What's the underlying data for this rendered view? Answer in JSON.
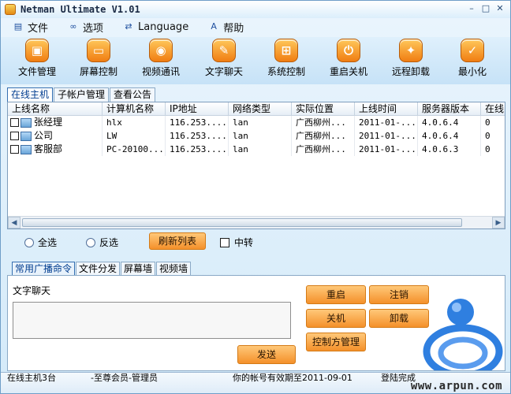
{
  "window": {
    "title": "Netman Ultimate V1.01",
    "min": "–",
    "max": "□",
    "close": "✕"
  },
  "menu": [
    {
      "label": "文件",
      "icon": "document-icon",
      "glyph": "▤"
    },
    {
      "label": "选项",
      "icon": "glasses-icon",
      "glyph": "∞"
    },
    {
      "label": "Language",
      "icon": "translate-icon",
      "glyph": "⇄"
    },
    {
      "label": "帮助",
      "icon": "font-help-icon",
      "glyph": "A"
    }
  ],
  "toolbar": [
    {
      "label": "文件管理",
      "icon": "folder-shield-icon",
      "glyph": "▣"
    },
    {
      "label": "屏幕控制",
      "icon": "monitor-icon",
      "glyph": "▭"
    },
    {
      "label": "视频通讯",
      "icon": "webcam-icon",
      "glyph": "◉"
    },
    {
      "label": "文字聊天",
      "icon": "chat-bubble-icon",
      "glyph": "✎"
    },
    {
      "label": "系统控制",
      "icon": "windows-logo-icon",
      "glyph": "⊞"
    },
    {
      "label": "重启关机",
      "icon": "power-icon",
      "glyph": "⏻"
    },
    {
      "label": "远程卸载",
      "icon": "wand-icon",
      "glyph": "✦"
    },
    {
      "label": "最小化",
      "icon": "minimize-check-icon",
      "glyph": "✓"
    }
  ],
  "main_tabs": [
    "在线主机",
    "子帐户管理",
    "查看公告"
  ],
  "table": {
    "columns": [
      "上线名称",
      "计算机名称",
      "IP地址",
      "网络类型",
      "实际位置",
      "上线时间",
      "服务器版本",
      "在线"
    ],
    "rows": [
      [
        "张经理",
        "hlx",
        "116.253....",
        "lan",
        "广西柳州...",
        "2011-01-...",
        "4.0.6.4",
        "0"
      ],
      [
        "公司",
        "LW",
        "116.253....",
        "lan",
        "广西柳州...",
        "2011-01-...",
        "4.0.6.4",
        "0"
      ],
      [
        "客服部",
        "PC-20100...",
        "116.253....",
        "lan",
        "广西柳州...",
        "2011-01-...",
        "4.0.6.3",
        "0"
      ]
    ]
  },
  "controls": {
    "select_all": "全选",
    "invert": "反选",
    "refresh": "刷新列表",
    "relay": "中转"
  },
  "lower_tabs": [
    "常用广播命令",
    "文件分发",
    "屏幕墙",
    "视频墙"
  ],
  "panel": {
    "chat_label": "文字聊天",
    "send": "发送",
    "restart": "重启",
    "logout": "注销",
    "shutdown": "关机",
    "uninstall": "卸载",
    "controller_mgmt": "控制方管理"
  },
  "status": {
    "online_count": "在线主机3台",
    "membership": "-至尊会员-管理员",
    "expiry": "你的帐号有效期至2011-09-01",
    "login_state": "登陆完成",
    "watermark": "www.arpun.com"
  },
  "colors": {
    "accent": "#f4902a",
    "frame": "#6f9ec8",
    "tab_active": "#003c8f"
  }
}
